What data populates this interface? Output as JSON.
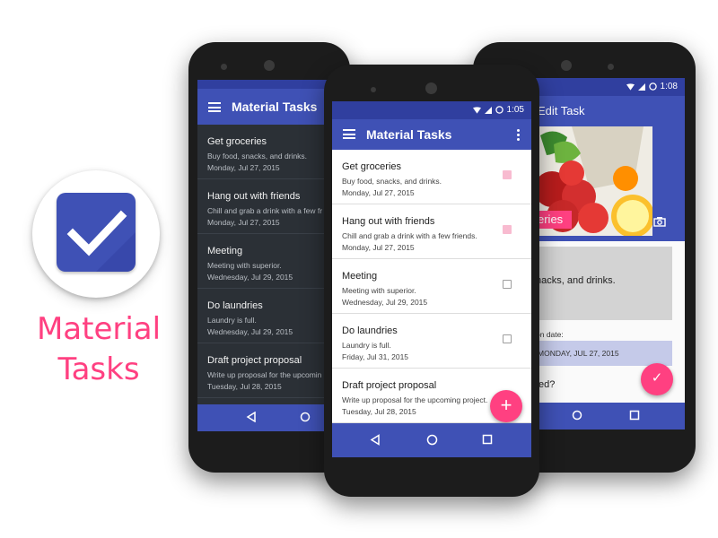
{
  "brand": {
    "line1": "Material",
    "line2": "Tasks",
    "accent_color": "#ff4081",
    "primary_color": "#3f51b5",
    "icon": "checkmark-icon"
  },
  "list_phone": {
    "status_time": "1:05",
    "app_title": "Material Tasks",
    "tasks": [
      {
        "title": "Get groceries",
        "desc": "Buy food, snacks, and drinks.",
        "date": "Monday, Jul 27, 2015",
        "done": true
      },
      {
        "title": "Hang out with friends",
        "desc": "Chill and grab a drink with a few friends.",
        "date": "Monday, Jul 27, 2015",
        "done": true
      },
      {
        "title": "Meeting",
        "desc": "Meeting with superior.",
        "date": "Wednesday, Jul 29, 2015",
        "done": false
      },
      {
        "title": "Do laundries",
        "desc": "Laundry is full.",
        "date": "Friday, Jul 31, 2015",
        "done": false
      },
      {
        "title": "Draft project proposal",
        "desc": "Write up proposal for the upcoming project.",
        "date": "Tuesday, Jul 28, 2015",
        "done": false
      }
    ],
    "fab_label": "+"
  },
  "dark_phone": {
    "app_title": "Material Tasks",
    "tasks": [
      {
        "title": "Get groceries",
        "desc": "Buy food, snacks, and drinks.",
        "date": "Monday, Jul 27, 2015"
      },
      {
        "title": "Hang out with friends",
        "desc": "Chill and grab a drink with a few fr",
        "date": "Monday, Jul 27, 2015"
      },
      {
        "title": "Meeting",
        "desc": "Meeting with superior.",
        "date": "Wednesday, Jul 29, 2015"
      },
      {
        "title": "Do laundries",
        "desc": "Laundry is full.",
        "date": "Wednesday, Jul 29, 2015"
      },
      {
        "title": "Draft project proposal",
        "desc": "Write up proposal for the upcomin",
        "date": "Tuesday, Jul 28, 2015"
      }
    ]
  },
  "edit_phone": {
    "status_time": "1:08",
    "app_title": "Edit Task",
    "image_caption": "eries",
    "description_text": "nacks, and drinks.",
    "due_label": "on date:",
    "due_value": "MONDAY, JUL 27, 2015",
    "completed_label": "ted?",
    "fab_label": "✓"
  }
}
